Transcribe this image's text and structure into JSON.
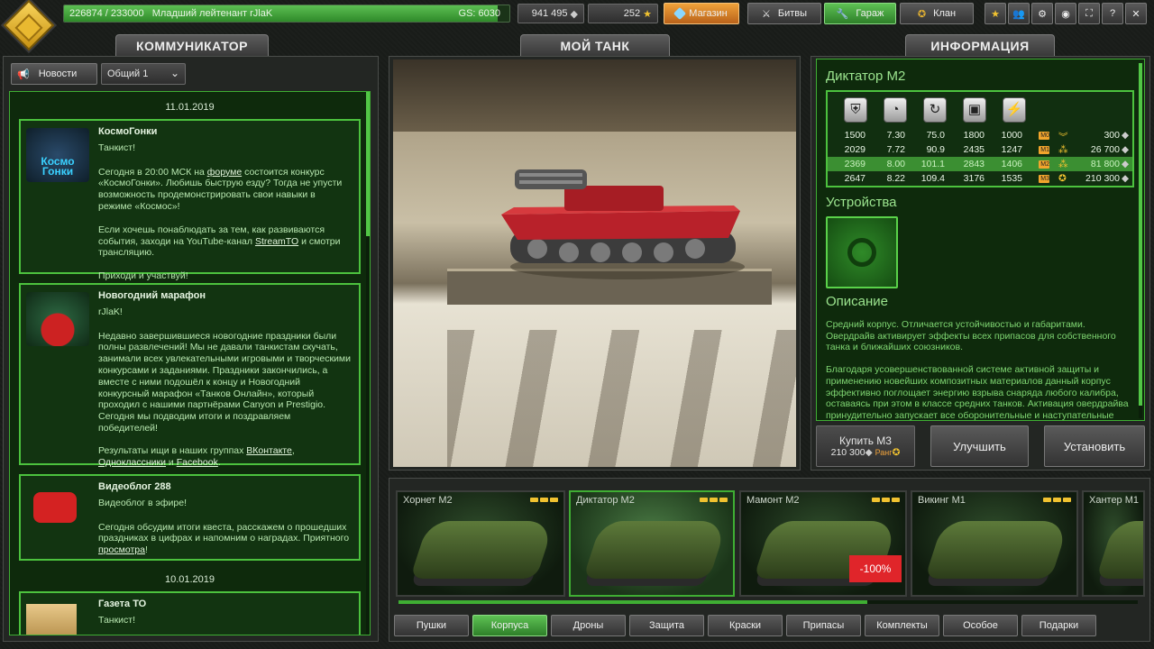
{
  "topbar": {
    "xp": "226874 / 233000",
    "rank": "Младший лейтенант rJlaK",
    "gs": "GS: 6030",
    "xp_progress": 0.974,
    "crystals": "941 495",
    "stars": "252",
    "shop": "Магазин",
    "battles": "Битвы",
    "garage": "Гараж",
    "clan": "Клан"
  },
  "headers": {
    "communicator": "КОММУНИКАТОР",
    "mytank": "МОЙ ТАНК",
    "info": "ИНФОРМАЦИЯ"
  },
  "news_controls": {
    "news_btn": "Новости",
    "channel": "Общий 1"
  },
  "news": {
    "date1": "11.01.2019",
    "date2": "10.01.2019",
    "n1": {
      "title": "КосмоГонки",
      "greet": "Танкист!",
      "p1a": "Сегодня в 20:00 МСК на ",
      "p1link": "форуме",
      "p1b": " состоится конкурс «КосмоГонки». Любишь быструю езду? Тогда не упусти возможность продемонстрировать свои навыки в режиме «Космос»!",
      "p2a": "Если хочешь понаблюдать за тем, как развиваются события, заходи на YouTube-канал ",
      "p2link": "StreamTO",
      "p2b": " и смотри трансляцию.",
      "p3": "Приходи и участвуй!",
      "pic1": "Космо",
      "pic2": "Гонки"
    },
    "n2": {
      "title": "Новогодний марафон",
      "greet": "rJlaK!",
      "p1": "Недавно завершившиеся новогодние праздники были полны развлечений! Мы не давали танкистам скучать, занимали всех увлекательными игровыми и творческими конкурсами и заданиями. Праздники закончились, а вместе с ними подошёл к концу и Новогодний конкурсный марафон «Танков Онлайн», который проходил с нашими партнёрами Canyon и Prestigio. Сегодня мы подводим итоги и поздравляем победителей!",
      "p2a": "Результаты ищи в наших группах ",
      "l1": "ВКонтакте",
      "comma": ",",
      "l2": "Одноклассники",
      "and": " и ",
      "l3": "Facebook",
      "dot": "."
    },
    "n3": {
      "title": "Видеоблог 288",
      "greet": "Видеоблог в эфире!",
      "p1": "Сегодня обсудим итоги квеста, расскажем о прошедших праздниках в цифрах и напомним о наградах. Приятного ",
      "link": "просмотра",
      "end": "!"
    },
    "n4": {
      "title": "Газета ТО",
      "greet": "Танкист!"
    }
  },
  "info": {
    "tank_name": "Диктатор M2",
    "rows": [
      {
        "c": [
          "1500",
          "7.30",
          "75.0",
          "1800",
          "1000"
        ],
        "mk": "M0",
        "price": "300"
      },
      {
        "c": [
          "2029",
          "7.72",
          "90.9",
          "2435",
          "1247"
        ],
        "mk": "M1",
        "price": "26 700"
      },
      {
        "c": [
          "2369",
          "8.00",
          "101.1",
          "2843",
          "1406"
        ],
        "mk": "M2",
        "price": "81 800"
      },
      {
        "c": [
          "2647",
          "8.22",
          "109.4",
          "3176",
          "1535"
        ],
        "mk": "M3",
        "price": "210 300"
      }
    ],
    "devices": "Устройства",
    "desc_title": "Описание",
    "desc1": "Средний корпус. Отличается устойчивостью и габаритами. Овердрайв активирует эффекты всех припасов для собственного танка и ближайших союзников.",
    "desc2": "Благодаря усовершенствованной системе активной защиты и применению новейших композитных материалов данный корпус эффективно поглощает энергию взрыва снаряда любого калибра, оставаясь при этом в классе средних танков. Активация овердрайва принудительно запускает все оборонительные и наступательные"
  },
  "actions": {
    "buy": "Купить M3",
    "buy_price": "210 300",
    "rank": "Ранг",
    "upgrade": "Улучшить",
    "install": "Установить"
  },
  "tanks": [
    {
      "name": "Хорнет M2"
    },
    {
      "name": "Диктатор M2"
    },
    {
      "name": "Мамонт M2",
      "discount": "-100%"
    },
    {
      "name": "Викинг M1"
    },
    {
      "name": "Хантер M1"
    }
  ],
  "tabs": [
    "Пушки",
    "Корпуса",
    "Дроны",
    "Защита",
    "Краски",
    "Припасы",
    "Комплекты",
    "Особое",
    "Подарки"
  ],
  "colors": {
    "accent": "#4cc23e",
    "shop": "#e08a2a"
  }
}
